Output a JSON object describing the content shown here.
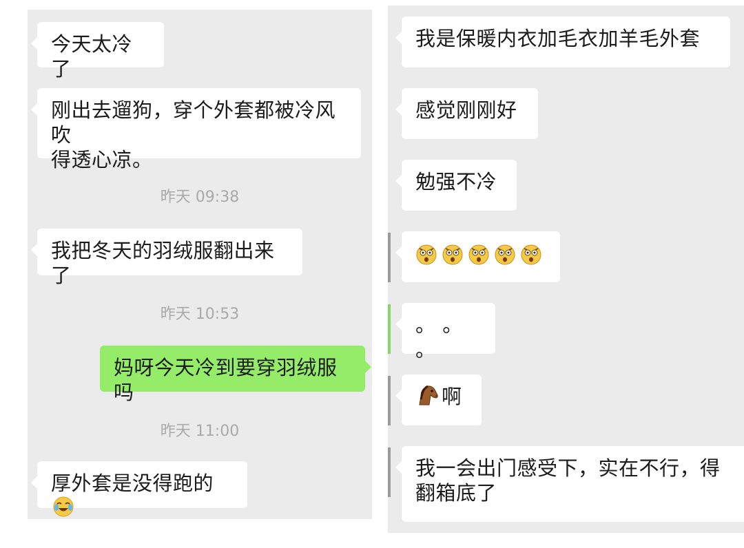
{
  "left_chat": {
    "messages": [
      {
        "text": "今天太冷了"
      },
      {
        "text_line1": "刚出去遛狗，穿个外套都被冷风吹",
        "text_line2": "得透心凉。"
      },
      {
        "time": "昨天 09:38"
      },
      {
        "text": "我把冬天的羽绒服翻出来了"
      },
      {
        "time": "昨天 10:53"
      },
      {
        "text": "妈呀今天冷到要穿羽绒服吗"
      },
      {
        "time": "昨天 11:00"
      },
      {
        "text": "厚外套是没得跑的",
        "emoji": "crying-laughing-emoji"
      }
    ]
  },
  "right_chat": {
    "messages": [
      {
        "text": "我是保暖内衣加毛衣加羊毛外套"
      },
      {
        "text": "感觉刚刚好"
      },
      {
        "text": "勉强不冷"
      },
      {
        "emoji": "astonished-face-emoji",
        "emoji_count": 5
      },
      {
        "text": "。 。 。"
      },
      {
        "emoji": "horse-emoji",
        "text": "啊"
      },
      {
        "text_line1": "我一会出门感受下，实在不行，得",
        "text_line2": "翻箱底了"
      }
    ]
  },
  "colors": {
    "chat_background": "#ebebeb",
    "incoming_bubble": "#ffffff",
    "outgoing_bubble": "#95ec69",
    "timestamp_text": "#a9a9a9"
  }
}
